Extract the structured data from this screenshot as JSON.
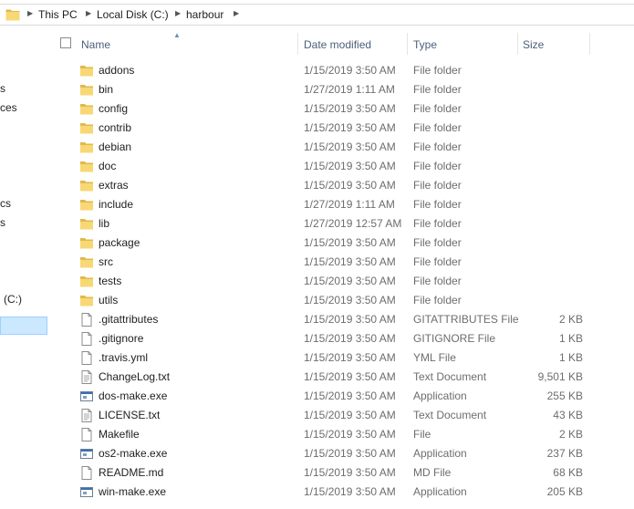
{
  "breadcrumb": {
    "items": [
      "This PC",
      "Local Disk (C:)",
      "harbour"
    ]
  },
  "nav": {
    "items": [
      "s",
      "ces",
      "cs",
      "s",
      "(C:)"
    ]
  },
  "columns": {
    "name": "Name",
    "date": "Date modified",
    "type": "Type",
    "size": "Size"
  },
  "files": [
    {
      "name": "addons",
      "date": "1/15/2019 3:50 AM",
      "type": "File folder",
      "size": "",
      "icon": "folder-icon"
    },
    {
      "name": "bin",
      "date": "1/27/2019 1:11 AM",
      "type": "File folder",
      "size": "",
      "icon": "folder-icon"
    },
    {
      "name": "config",
      "date": "1/15/2019 3:50 AM",
      "type": "File folder",
      "size": "",
      "icon": "folder-icon"
    },
    {
      "name": "contrib",
      "date": "1/15/2019 3:50 AM",
      "type": "File folder",
      "size": "",
      "icon": "folder-icon"
    },
    {
      "name": "debian",
      "date": "1/15/2019 3:50 AM",
      "type": "File folder",
      "size": "",
      "icon": "folder-icon"
    },
    {
      "name": "doc",
      "date": "1/15/2019 3:50 AM",
      "type": "File folder",
      "size": "",
      "icon": "folder-icon"
    },
    {
      "name": "extras",
      "date": "1/15/2019 3:50 AM",
      "type": "File folder",
      "size": "",
      "icon": "folder-icon"
    },
    {
      "name": "include",
      "date": "1/27/2019 1:11 AM",
      "type": "File folder",
      "size": "",
      "icon": "folder-icon"
    },
    {
      "name": "lib",
      "date": "1/27/2019 12:57 AM",
      "type": "File folder",
      "size": "",
      "icon": "folder-icon"
    },
    {
      "name": "package",
      "date": "1/15/2019 3:50 AM",
      "type": "File folder",
      "size": "",
      "icon": "folder-icon"
    },
    {
      "name": "src",
      "date": "1/15/2019 3:50 AM",
      "type": "File folder",
      "size": "",
      "icon": "folder-icon"
    },
    {
      "name": "tests",
      "date": "1/15/2019 3:50 AM",
      "type": "File folder",
      "size": "",
      "icon": "folder-icon"
    },
    {
      "name": "utils",
      "date": "1/15/2019 3:50 AM",
      "type": "File folder",
      "size": "",
      "icon": "folder-icon"
    },
    {
      "name": ".gitattributes",
      "date": "1/15/2019 3:50 AM",
      "type": "GITATTRIBUTES File",
      "size": "2 KB",
      "icon": "file-icon"
    },
    {
      "name": ".gitignore",
      "date": "1/15/2019 3:50 AM",
      "type": "GITIGNORE File",
      "size": "1 KB",
      "icon": "file-icon"
    },
    {
      "name": ".travis.yml",
      "date": "1/15/2019 3:50 AM",
      "type": "YML File",
      "size": "1 KB",
      "icon": "file-icon"
    },
    {
      "name": "ChangeLog.txt",
      "date": "1/15/2019 3:50 AM",
      "type": "Text Document",
      "size": "9,501 KB",
      "icon": "text-file-icon"
    },
    {
      "name": "dos-make.exe",
      "date": "1/15/2019 3:50 AM",
      "type": "Application",
      "size": "255 KB",
      "icon": "application-icon"
    },
    {
      "name": "LICENSE.txt",
      "date": "1/15/2019 3:50 AM",
      "type": "Text Document",
      "size": "43 KB",
      "icon": "text-file-icon"
    },
    {
      "name": "Makefile",
      "date": "1/15/2019 3:50 AM",
      "type": "File",
      "size": "2 KB",
      "icon": "file-icon"
    },
    {
      "name": "os2-make.exe",
      "date": "1/15/2019 3:50 AM",
      "type": "Application",
      "size": "237 KB",
      "icon": "application-icon"
    },
    {
      "name": "README.md",
      "date": "1/15/2019 3:50 AM",
      "type": "MD File",
      "size": "68 KB",
      "icon": "file-icon"
    },
    {
      "name": "win-make.exe",
      "date": "1/15/2019 3:50 AM",
      "type": "Application",
      "size": "205 KB",
      "icon": "application-icon"
    }
  ],
  "colors": {
    "folder": "#f8d775",
    "folder_dark": "#e0b94c",
    "header_text": "#4c607a",
    "selection": "#cce8ff"
  }
}
